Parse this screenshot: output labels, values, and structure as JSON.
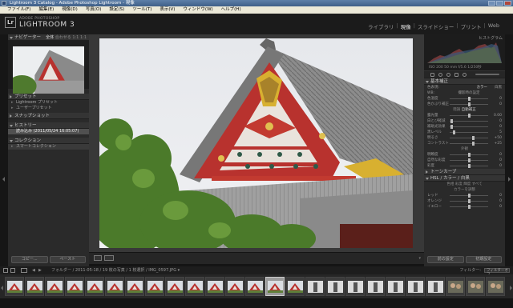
{
  "window": {
    "title": "Lightroom 3 Catalog - Adobe Photoshop Lightroom - 現像"
  },
  "menu": [
    "ファイル(F)",
    "編集(E)",
    "現像(D)",
    "写真(O)",
    "設定(S)",
    "ツール(T)",
    "表示(V)",
    "ウィンドウ(W)",
    "ヘルプ(H)"
  ],
  "identity": {
    "badge": "Lr",
    "adobe": "ADOBE PHOTOSHOP",
    "product": "LIGHTROOM 3"
  },
  "modules": [
    "ライブラリ",
    "現像",
    "スライドショー",
    "プリント",
    "Web"
  ],
  "active_module": "現像",
  "left": {
    "navigator": {
      "label": "ナビゲーター",
      "zoom": [
        "全体",
        "合わせる",
        "1:1",
        "1:1"
      ]
    },
    "presets": {
      "label": "プリセット",
      "items": [
        "Lightroom プリセット",
        "ユーザープリセット"
      ]
    },
    "snapshots": {
      "label": "スナップショット"
    },
    "history": {
      "label": "ヒストリー",
      "item": "読み込み (2011/05/24 16:05:07)"
    },
    "collections": {
      "label": "コレクション",
      "item": "スマートコレクション"
    },
    "copy_label": "コピー...",
    "paste_label": "ペースト"
  },
  "right": {
    "histogram": {
      "label": "ヒストグラム",
      "info": "ISO 200  50 mm  f/5.6  1/250秒"
    },
    "basic": {
      "label": "基本補正",
      "treatment_label": "色表現:",
      "treatment_color": "カラー",
      "treatment_bw": "白黒"
    },
    "wb_label": "WB:",
    "wb_value": "撮影時の設定",
    "sliders1": [
      {
        "name": "色温度",
        "value": "0",
        "pos": 0.5
      },
      {
        "name": "色かぶり補正",
        "value": "0",
        "pos": 0.5
      }
    ],
    "tone_label": "階調",
    "auto_label": "自動補正",
    "sliders2": [
      {
        "name": "露光量",
        "value": "0.00",
        "pos": 0.5
      },
      {
        "name": "白とび軽減",
        "value": "0",
        "pos": 0.05
      },
      {
        "name": "補助光効果",
        "value": "0",
        "pos": 0.05
      },
      {
        "name": "黒レベル",
        "value": "5",
        "pos": 0.1
      }
    ],
    "sliders3": [
      {
        "name": "明るさ",
        "value": "+50",
        "pos": 0.6
      },
      {
        "name": "コントラスト",
        "value": "+25",
        "pos": 0.6
      }
    ],
    "presence_label": "外観",
    "sliders4": [
      {
        "name": "明瞭度",
        "value": "0",
        "pos": 0.5
      },
      {
        "name": "自然な彩度",
        "value": "0",
        "pos": 0.5
      },
      {
        "name": "彩度",
        "value": "0",
        "pos": 0.5
      }
    ],
    "tone_curve_label": "トーンカーブ",
    "hsl_label": "HSL / カラー / 白黒",
    "hsl_row1": "色相 彩度 輝度 すべて",
    "hsl_sub": "カラーを調整",
    "sliders5": [
      {
        "name": "レッド",
        "value": "0",
        "pos": 0.5
      },
      {
        "name": "オレンジ",
        "value": "0",
        "pos": 0.5
      },
      {
        "name": "イエロー",
        "value": "0",
        "pos": 0.5
      }
    ],
    "prev_label": "前の設定",
    "reset_label": "初期設定"
  },
  "toolbar": {
    "dropdown": "▾"
  },
  "filmstrip": {
    "pages": [
      "1",
      "2"
    ],
    "crumb": "フォルダー / 2011-05-18 / 19 枚の写真 / 1 枚選択 / IMG_0597.JPG ▾",
    "filter_label": "フィルター:",
    "filter_value": "フィルターオフ",
    "selected_index": 13,
    "thumbs": [
      "roof",
      "roof",
      "roof",
      "roof",
      "roof",
      "roof",
      "roof",
      "roof",
      "roof",
      "roof",
      "roof",
      "roof",
      "roof",
      "roof",
      "roof",
      "bw",
      "bw",
      "bw",
      "bw",
      "bw",
      "bw",
      "bw",
      "people",
      "people",
      "people"
    ]
  },
  "colors": {
    "accent": "#d8d8d8",
    "panel": "#2a2a2a",
    "roof_red": "#b8322e",
    "gold": "#d8b030"
  }
}
